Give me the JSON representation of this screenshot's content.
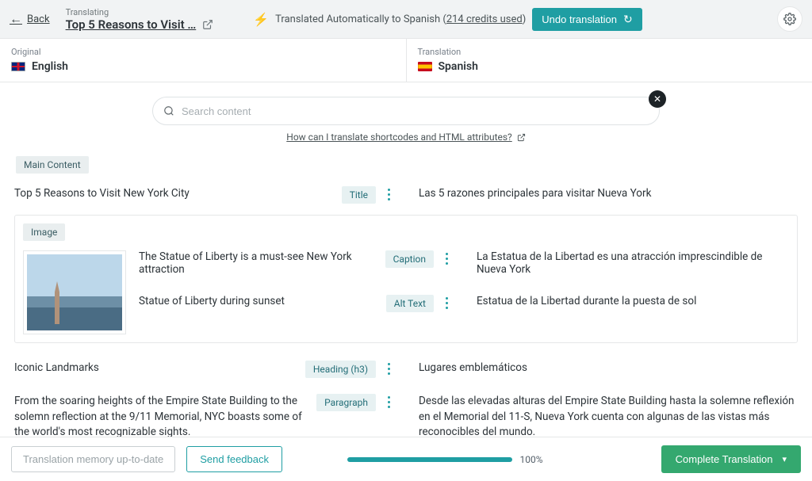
{
  "header": {
    "back_label": "Back",
    "translating_label": "Translating",
    "page_title": "Top 5 Reasons to Visit …",
    "auto_text_prefix": "Translated Automatically to Spanish (",
    "credits_text": "214 credits used",
    "auto_text_suffix": ")",
    "undo_label": "Undo translation"
  },
  "langs": {
    "original_label": "Original",
    "original_name": "English",
    "translation_label": "Translation",
    "translation_name": "Spanish"
  },
  "search": {
    "placeholder": "Search content",
    "help_link": "How can I translate shortcodes and HTML attributes?"
  },
  "content": {
    "main_content_label": "Main Content",
    "image_label": "Image",
    "rows": {
      "title": {
        "chip": "Title",
        "src": "Top 5 Reasons to Visit New York City",
        "tgt": "Las 5 razones principales para visitar Nueva York"
      },
      "caption": {
        "chip": "Caption",
        "src": "The Statue of Liberty is a must-see New York attraction",
        "tgt": "La Estatua de la Libertad es una atracción imprescindible de Nueva York"
      },
      "alt": {
        "chip": "Alt Text",
        "src": "Statue of Liberty during sunset",
        "tgt": "Estatua de la Libertad durante la puesta de sol"
      },
      "heading": {
        "chip": "Heading (h3)",
        "src": "Iconic Landmarks",
        "tgt": "Lugares emblemáticos"
      },
      "paragraph": {
        "chip": "Paragraph",
        "src": "From the soaring heights of the Empire State Building to the solemn reflection at the 9/11 Memorial, NYC boasts some of the world's most recognizable sights.",
        "tgt": "Desde las elevadas alturas del Empire State Building hasta la solemne reflexión en el Memorial del 11-S, Nueva York cuenta con algunas de las vistas más reconocibles del mundo."
      }
    }
  },
  "footer": {
    "memory_label": "Translation memory up-to-date",
    "feedback_label": "Send feedback",
    "progress_label": "100%",
    "complete_label": "Complete Translation"
  }
}
